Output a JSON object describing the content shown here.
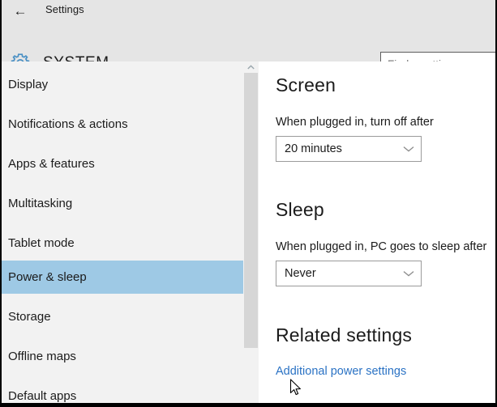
{
  "window": {
    "back_icon": "back-arrow-icon",
    "title": "Settings"
  },
  "header": {
    "icon": "gear-icon",
    "category": "SYSTEM",
    "search": {
      "placeholder": "Find a setting",
      "value": ""
    }
  },
  "colors": {
    "header_bg": "#E5E5E5",
    "sidebar_bg": "#F2F2F2",
    "selection": "#9EC9E5",
    "accent_link": "#2A72C4",
    "gear_blue": "#4A90C4",
    "scrollbar_thumb": "#D6D6D6"
  },
  "sidebar": {
    "selected_index": 5,
    "items": [
      {
        "label": "Display"
      },
      {
        "label": "Notifications & actions"
      },
      {
        "label": "Apps & features"
      },
      {
        "label": "Multitasking"
      },
      {
        "label": "Tablet mode"
      },
      {
        "label": "Power & sleep"
      },
      {
        "label": "Storage"
      },
      {
        "label": "Offline maps"
      },
      {
        "label": "Default apps"
      }
    ]
  },
  "main": {
    "screen": {
      "heading": "Screen",
      "label": "When plugged in, turn off after",
      "dropdown_value": "20 minutes",
      "chevron": "chevron-down-icon"
    },
    "sleep": {
      "heading": "Sleep",
      "label": "When plugged in, PC goes to sleep after",
      "dropdown_value": "Never",
      "chevron": "chevron-down-icon"
    },
    "related": {
      "heading": "Related settings",
      "link": "Additional power settings"
    }
  }
}
